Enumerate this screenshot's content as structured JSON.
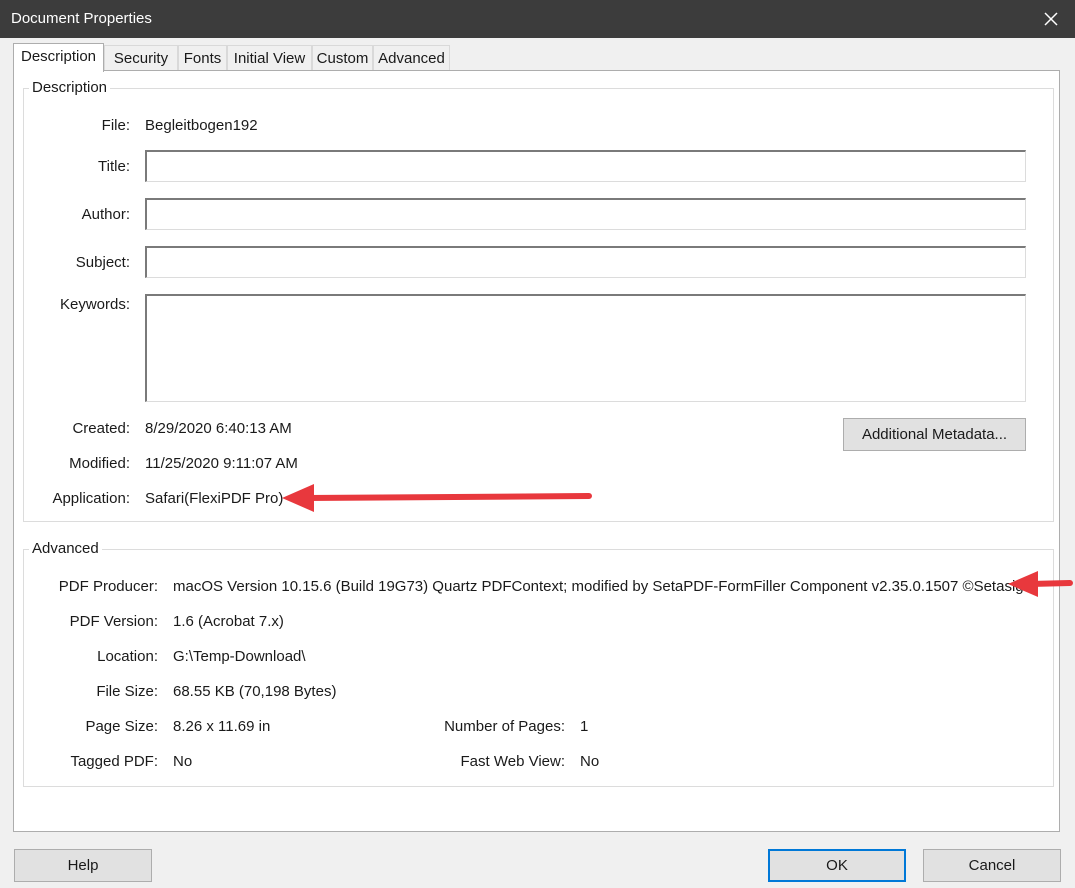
{
  "window": {
    "title": "Document Properties",
    "close_icon": "close-icon"
  },
  "tabs": [
    {
      "label": "Description",
      "active": true
    },
    {
      "label": "Security"
    },
    {
      "label": "Fonts"
    },
    {
      "label": "Initial View"
    },
    {
      "label": "Custom"
    },
    {
      "label": "Advanced"
    }
  ],
  "description": {
    "group_label": "Description",
    "file_label": "File:",
    "file_value": "Begleitbogen192",
    "title_label": "Title:",
    "title_value": "",
    "author_label": "Author:",
    "author_value": "",
    "subject_label": "Subject:",
    "subject_value": "",
    "keywords_label": "Keywords:",
    "keywords_value": "",
    "created_label": "Created:",
    "created_value": "8/29/2020 6:40:13 AM",
    "modified_label": "Modified:",
    "modified_value": "11/25/2020 9:11:07 AM",
    "application_label": "Application:",
    "application_value": "Safari(FlexiPDF Pro)",
    "additional_metadata_button": "Additional Metadata..."
  },
  "advanced": {
    "group_label": "Advanced",
    "producer_label": "PDF Producer:",
    "producer_value": "macOS Version 10.15.6 (Build 19G73) Quartz PDFContext; modified by SetaPDF-FormFiller Component v2.35.0.1507 ©Setasign",
    "version_label": "PDF Version:",
    "version_value": "1.6 (Acrobat 7.x)",
    "location_label": "Location:",
    "location_value": "G:\\Temp-Download\\",
    "filesize_label": "File Size:",
    "filesize_value": "68.55 KB (70,198 Bytes)",
    "pagesize_label": "Page Size:",
    "pagesize_value": "8.26 x 11.69 in",
    "numpages_label": "Number of Pages:",
    "numpages_value": "1",
    "tagged_label": "Tagged PDF:",
    "tagged_value": "No",
    "fastweb_label": "Fast Web View:",
    "fastweb_value": "No"
  },
  "footer": {
    "help": "Help",
    "ok": "OK",
    "cancel": "Cancel"
  },
  "colors": {
    "titlebar": "#3c3c3c",
    "annotation_arrow": "#e8383d",
    "focus_border": "#0078d7"
  }
}
